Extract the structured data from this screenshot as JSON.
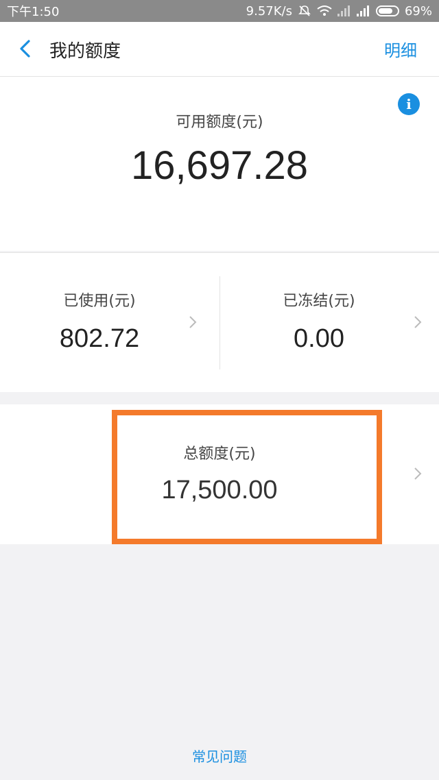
{
  "status_bar": {
    "time": "下午1:50",
    "network_speed": "9.57K/s",
    "battery": "69%"
  },
  "nav": {
    "title": "我的额度",
    "detail_label": "明细",
    "icons": {
      "back": "chevron-left-icon"
    }
  },
  "available": {
    "label": "可用额度(元)",
    "value": "16,697.28",
    "icons": {
      "info": "info-icon"
    }
  },
  "used": {
    "label": "已使用(元)",
    "value": "802.72"
  },
  "frozen": {
    "label": "已冻结(元)",
    "value": "0.00"
  },
  "total": {
    "label": "总额度(元)",
    "value": "17,500.00"
  },
  "footer": {
    "faq_label": "常见问题"
  },
  "colors": {
    "accent": "#1a8fe0",
    "highlight": "#f47a2b",
    "status_bar": "#8a8a8a",
    "background": "#f2f2f4"
  }
}
